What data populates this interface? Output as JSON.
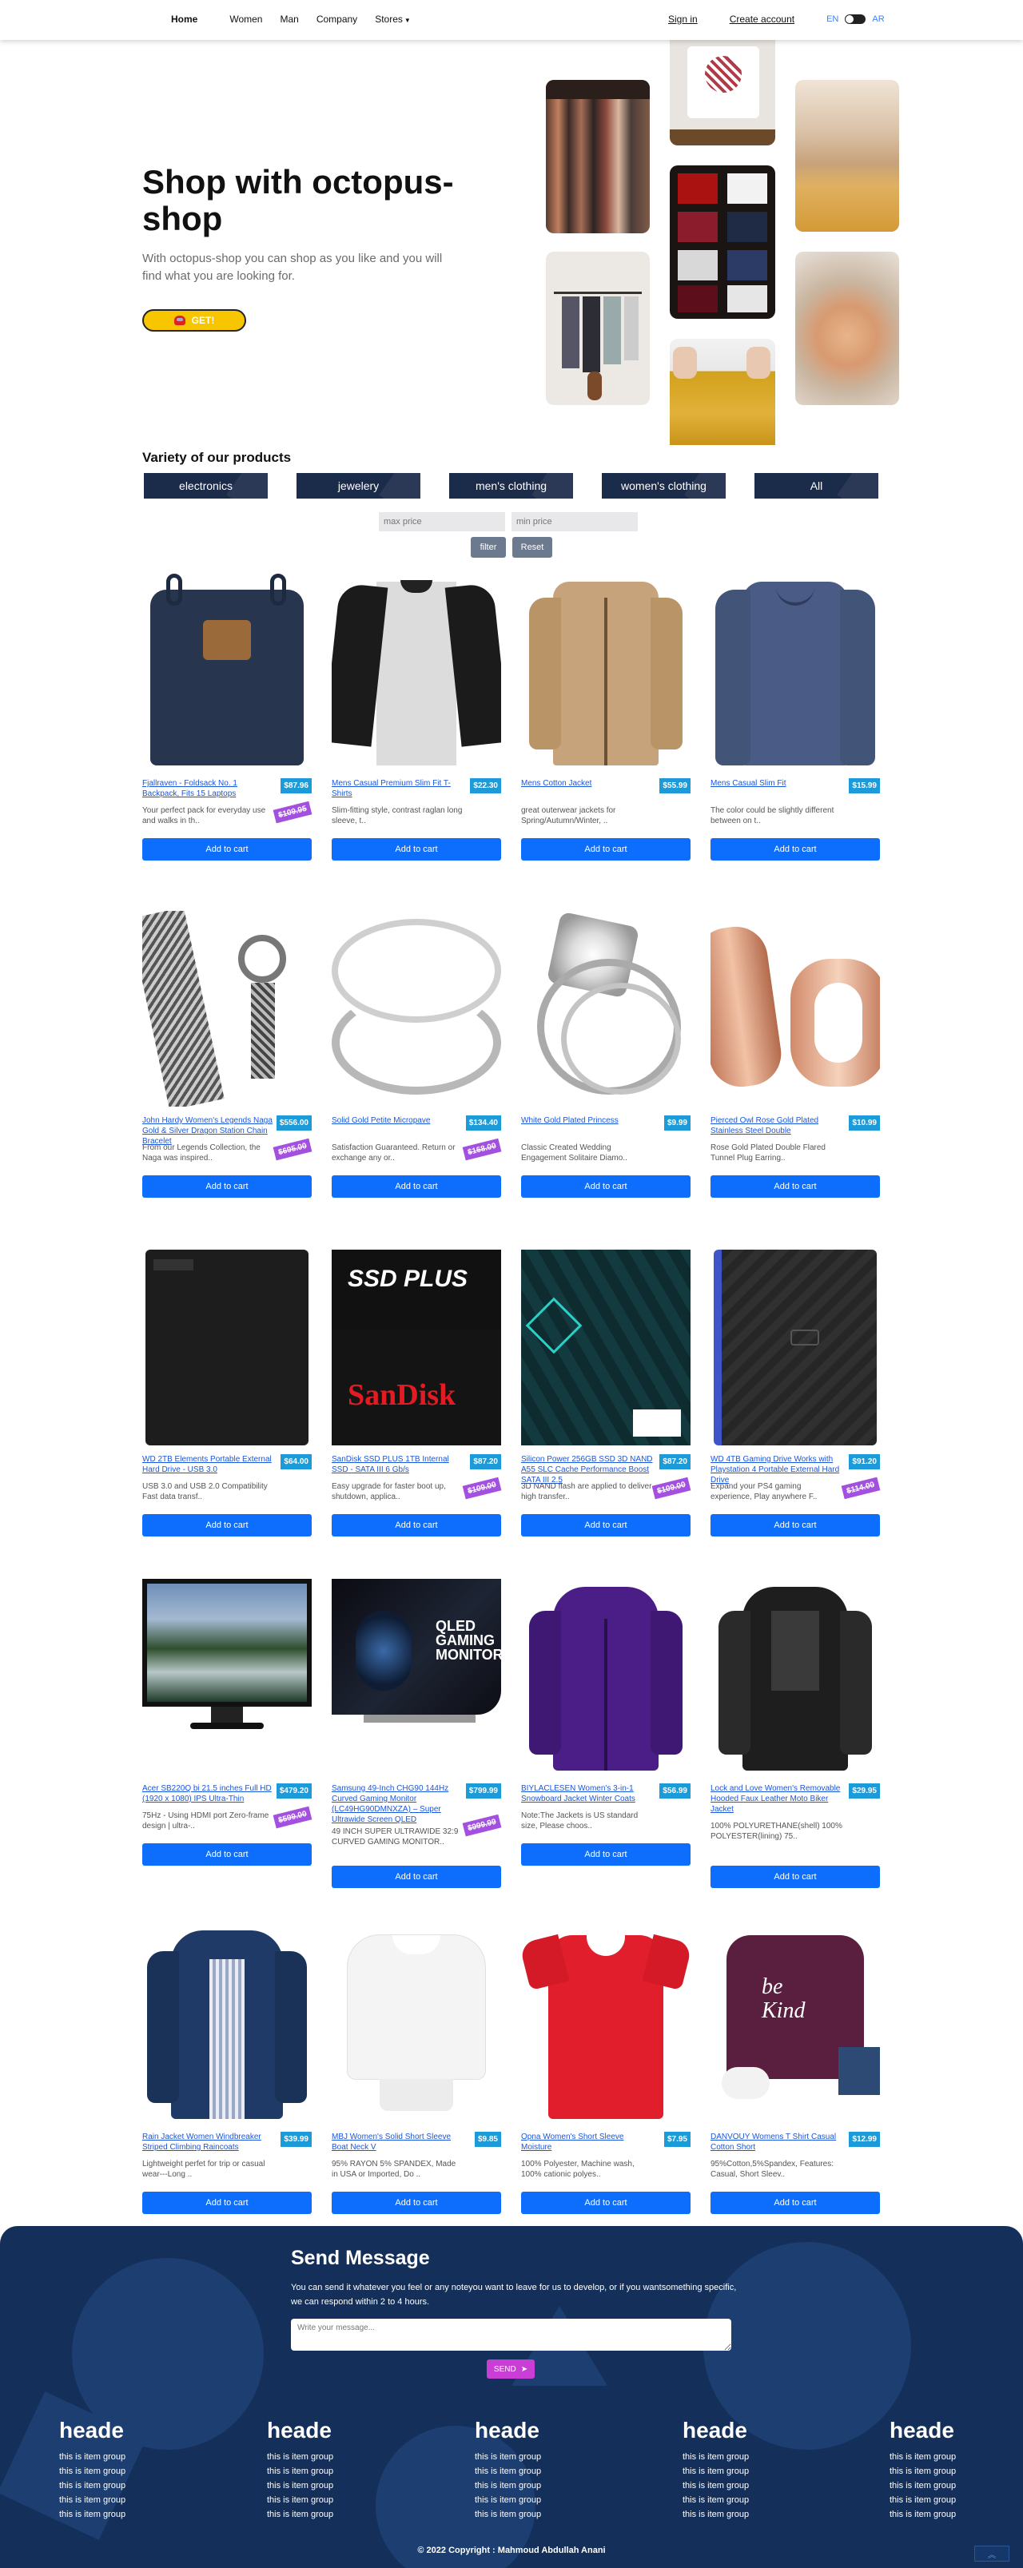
{
  "nav": {
    "home": "Home",
    "links": [
      "Women",
      "Man",
      "Company"
    ],
    "stores": "Stores",
    "signin": "Sign in",
    "create_account": "Create account",
    "lang_en": "EN",
    "lang_ar": "AR"
  },
  "hero": {
    "title": "Shop with octopus-shop",
    "subtitle": "With octopus-shop you can shop as you like and you will find what you are looking for.",
    "cta": "GET!"
  },
  "categories": {
    "title": "Variety of our products",
    "items": [
      "electronics",
      "jewelery",
      "men's clothing",
      "women's clothing",
      "All"
    ]
  },
  "filters": {
    "max_placeholder": "max price",
    "min_placeholder": "min price",
    "filter_label": "filter",
    "reset_label": "Reset"
  },
  "add_label": "Add to cart",
  "products": [
    {
      "title": "Fjallraven - Foldsack No. 1 Backpack, Fits 15 Laptops",
      "price": "$87.96",
      "old": "$109.95",
      "desc": "Your perfect pack for everyday use and walks in th.."
    },
    {
      "title": "Mens Casual Premium Slim Fit T-Shirts",
      "price": "$22.30",
      "old": "",
      "desc": "Slim-fitting style, contrast raglan long sleeve, t.."
    },
    {
      "title": "Mens Cotton Jacket",
      "price": "$55.99",
      "old": "",
      "desc": "great outerwear jackets for Spring/Autumn/Winter, .."
    },
    {
      "title": "Mens Casual Slim Fit",
      "price": "$15.99",
      "old": "",
      "desc": "The color could be slightly different between on t.."
    },
    {
      "title": "John Hardy Women's Legends Naga Gold & Silver Dragon Station Chain Bracelet",
      "price": "$556.00",
      "old": "$695.00",
      "desc": "From our Legends Collection, the Naga was inspired.."
    },
    {
      "title": "Solid Gold Petite Micropave",
      "price": "$134.40",
      "old": "$168.00",
      "desc": "Satisfaction Guaranteed. Return or exchange any or.."
    },
    {
      "title": "White Gold Plated Princess",
      "price": "$9.99",
      "old": "",
      "desc": "Classic Created Wedding Engagement Solitaire Diamo.."
    },
    {
      "title": "Pierced Owl Rose Gold Plated Stainless Steel Double",
      "price": "$10.99",
      "old": "",
      "desc": "Rose Gold Plated Double Flared Tunnel Plug Earring.."
    },
    {
      "title": "WD 2TB Elements Portable External Hard Drive - USB 3.0",
      "price": "$64.00",
      "old": "",
      "desc": "USB 3.0 and USB 2.0 Compatibility Fast data transf.."
    },
    {
      "title": "SanDisk SSD PLUS 1TB Internal SSD - SATA III 6 Gb/s",
      "price": "$87.20",
      "old": "$109.00",
      "desc": "Easy upgrade for faster boot up, shutdown, applica.."
    },
    {
      "title": "Silicon Power 256GB SSD 3D NAND A55 SLC Cache Performance Boost SATA III 2.5",
      "price": "$87.20",
      "old": "$109.00",
      "desc": "3D NAND flash are applied to deliver high transfer.."
    },
    {
      "title": "WD 4TB Gaming Drive Works with Playstation 4 Portable External Hard Drive",
      "price": "$91.20",
      "old": "$114.00",
      "desc": "Expand your PS4 gaming experience, Play anywhere F.."
    },
    {
      "title": "Acer SB220Q bi 21.5 inches Full HD (1920 x 1080) IPS Ultra-Thin",
      "price": "$479.20",
      "old": "$599.00",
      "desc": "75Hz - Using HDMI port Zero-frame design | ultra-.."
    },
    {
      "title": "Samsung 49-Inch CHG90 144Hz Curved Gaming Monitor (LC49HG90DMNXZA) – Super Ultrawide Screen QLED",
      "price": "$799.99",
      "old": "$999.99",
      "desc": "49 INCH SUPER ULTRAWIDE 32:9 CURVED GAMING MONITOR.."
    },
    {
      "title": "BIYLACLESEN Women's 3-in-1 Snowboard Jacket Winter Coats",
      "price": "$56.99",
      "old": "",
      "desc": "Note:The Jackets is US standard size, Please choos.."
    },
    {
      "title": "Lock and Love Women's Removable Hooded Faux Leather Moto Biker Jacket",
      "price": "$29.95",
      "old": "",
      "desc": "100% POLYURETHANE(shell) 100% POLYESTER(lining) 75.."
    },
    {
      "title": "Rain Jacket Women Windbreaker Striped Climbing Raincoats",
      "price": "$39.99",
      "old": "",
      "desc": "Lightweight perfet for trip or casual wear---Long .."
    },
    {
      "title": "MBJ Women's Solid Short Sleeve Boat Neck V",
      "price": "$9.85",
      "old": "",
      "desc": "95% RAYON 5% SPANDEX, Made in USA or Imported, Do .."
    },
    {
      "title": "Opna Women's Short Sleeve Moisture",
      "price": "$7.95",
      "old": "",
      "desc": "100% Polyester, Machine wash, 100% cationic polyes.."
    },
    {
      "title": "DANVOUY Womens T Shirt Casual Cotton Short",
      "price": "$12.99",
      "old": "",
      "desc": "95%Cotton,5%Spandex, Features: Casual, Short Sleev.."
    }
  ],
  "footer": {
    "send_title": "Send Message",
    "send_desc": "You can send it whatever you feel or any noteyou want to leave for us to develop, or if you wantsomething specific, we can respond within 2 to 4 hours.",
    "msg_placeholder": "Write your message...",
    "send_label": "SEND",
    "columns": [
      {
        "heading": "heade",
        "items": [
          "this is item group",
          "this is item group",
          "this is item group",
          "this is item group",
          "this is item group"
        ]
      },
      {
        "heading": "heade",
        "items": [
          "this is item group",
          "this is item group",
          "this is item group",
          "this is item group",
          "this is item group"
        ]
      },
      {
        "heading": "heade",
        "items": [
          "this is item group",
          "this is item group",
          "this is item group",
          "this is item group",
          "this is item group"
        ]
      },
      {
        "heading": "heade",
        "items": [
          "this is item group",
          "this is item group",
          "this is item group",
          "this is item group",
          "this is item group"
        ]
      },
      {
        "heading": "heade",
        "items": [
          "this is item group",
          "this is item group",
          "this is item group",
          "this is item group",
          "this is item group"
        ]
      }
    ],
    "copyright": "© 2022 Copyright : Mahmoud Abdullah Anani",
    "up_icon": "double-chevron-up"
  },
  "colors": {
    "category_bg": "#1b2b4a",
    "price_badge": "#1d9bd8",
    "old_price_badge": "#a34fe0",
    "add_button": "#0d6efd",
    "footer_bg": "#14305a",
    "cta_yellow": "#f7c600"
  }
}
